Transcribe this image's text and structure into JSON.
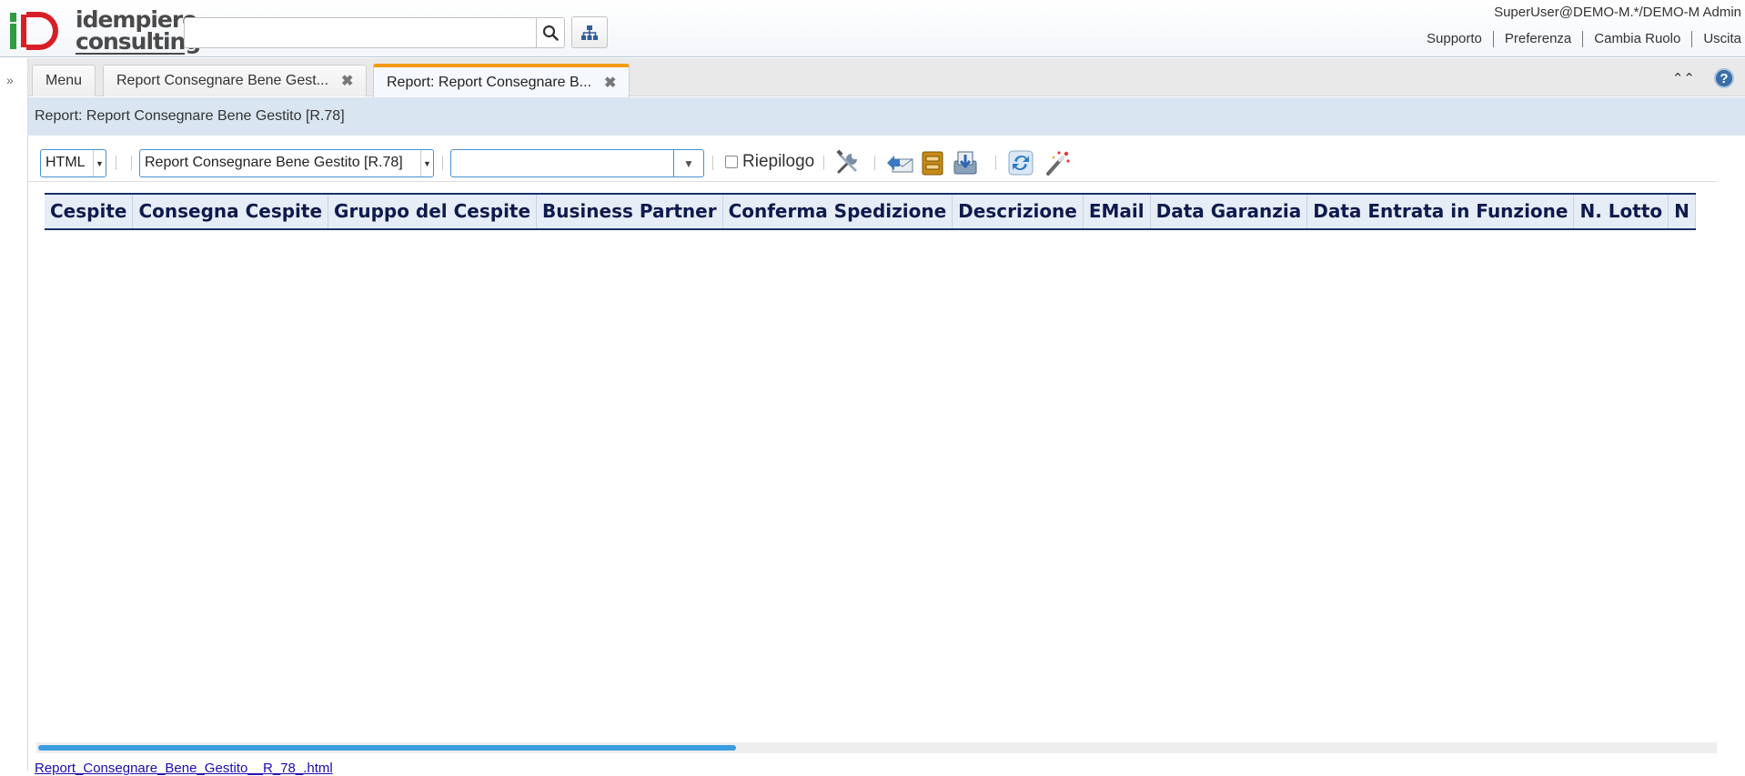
{
  "header": {
    "logo_line1": "idempiere",
    "logo_line2": "consulting",
    "search_placeholder": "",
    "user": "SuperUser@DEMO-M.*/DEMO-M Admin",
    "links": [
      "Supporto",
      "Preferenza",
      "Cambia Ruolo",
      "Uscita"
    ]
  },
  "tabs": [
    {
      "label": "Menu",
      "closable": false
    },
    {
      "label": "Report Consegnare Bene Gest...",
      "closable": true
    },
    {
      "label": "Report: Report Consegnare B...",
      "closable": true,
      "active": true
    }
  ],
  "title": "Report: Report Consegnare Bene Gestito [R.78]",
  "toolbar": {
    "format": "HTML",
    "report": "Report Consegnare Bene Gestito [R.78]",
    "combo_value": "",
    "summary_label": "Riepilogo",
    "summary_checked": false,
    "icons": [
      "tools-icon",
      "send-mail-icon",
      "archive-icon",
      "export-icon",
      "refresh-icon",
      "wizard-icon"
    ]
  },
  "table": {
    "columns": [
      "Cespite",
      "Consegna Cespite",
      "Gruppo del Cespite",
      "Business Partner",
      "Conferma Spedizione",
      "Descrizione",
      "EMail",
      "Data Garanzia",
      "Data Entrata in Funzione",
      "N. Lotto",
      "N"
    ]
  },
  "footer": {
    "file_link": "Report_Consegnare_Bene_Gestito__R_78_.html"
  },
  "colors": {
    "accent_tab": "#f39c12",
    "title_strip": "#d9e6f1",
    "table_header_text": "#0d1a4d",
    "scroll_thumb": "#3a9ee0"
  }
}
